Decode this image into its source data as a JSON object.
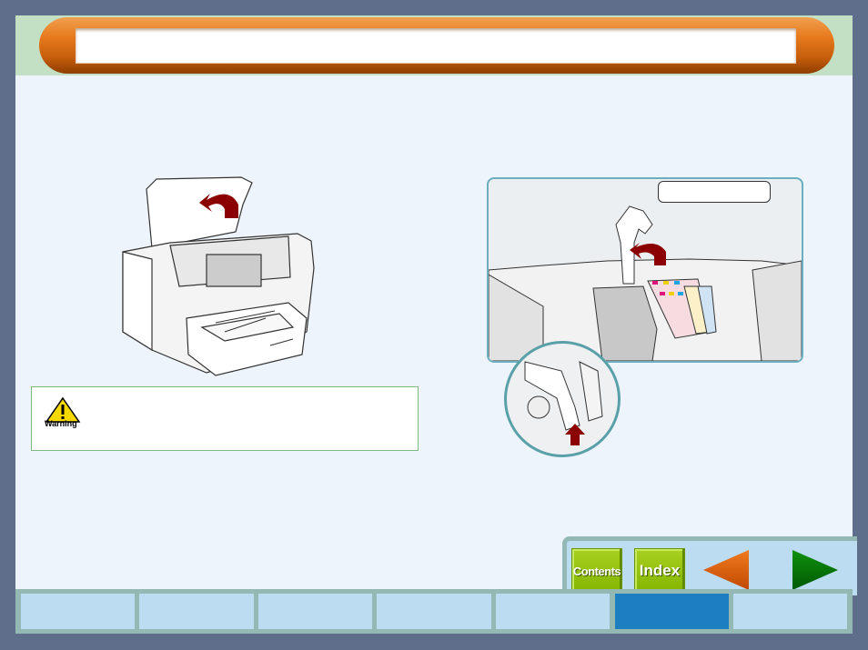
{
  "header": {
    "title": ""
  },
  "figures": {
    "printer_open_cover": {
      "description": "Printer with top cover open, arrow indicating lift"
    },
    "cartridge_lever": {
      "description": "Close-up of cartridge holders with lever raised",
      "callout_text": ""
    }
  },
  "warning": {
    "label": "Warning",
    "text": ""
  },
  "nav": {
    "contents_label": "Contents",
    "index_label": "Index",
    "prev_icon": "left-arrow-icon",
    "next_icon": "right-arrow-icon"
  },
  "tabs": [
    {
      "label": "",
      "active": false
    },
    {
      "label": "",
      "active": false
    },
    {
      "label": "",
      "active": false
    },
    {
      "label": "",
      "active": false
    },
    {
      "label": "",
      "active": false
    },
    {
      "label": "",
      "active": true
    },
    {
      "label": "",
      "active": false
    }
  ],
  "colors": {
    "frame": "#5f6e8a",
    "page_bg": "#edf4fb",
    "header_band": "#c3dfc4",
    "title_orange": "#e77a1c",
    "nav_green": "#8cbc00",
    "prev_arrow": "#d95f0a",
    "next_arrow": "#007000",
    "tab_bg": "#bcdcf2",
    "tab_active": "#1e7fc0",
    "arrow_red": "#8b0000"
  }
}
